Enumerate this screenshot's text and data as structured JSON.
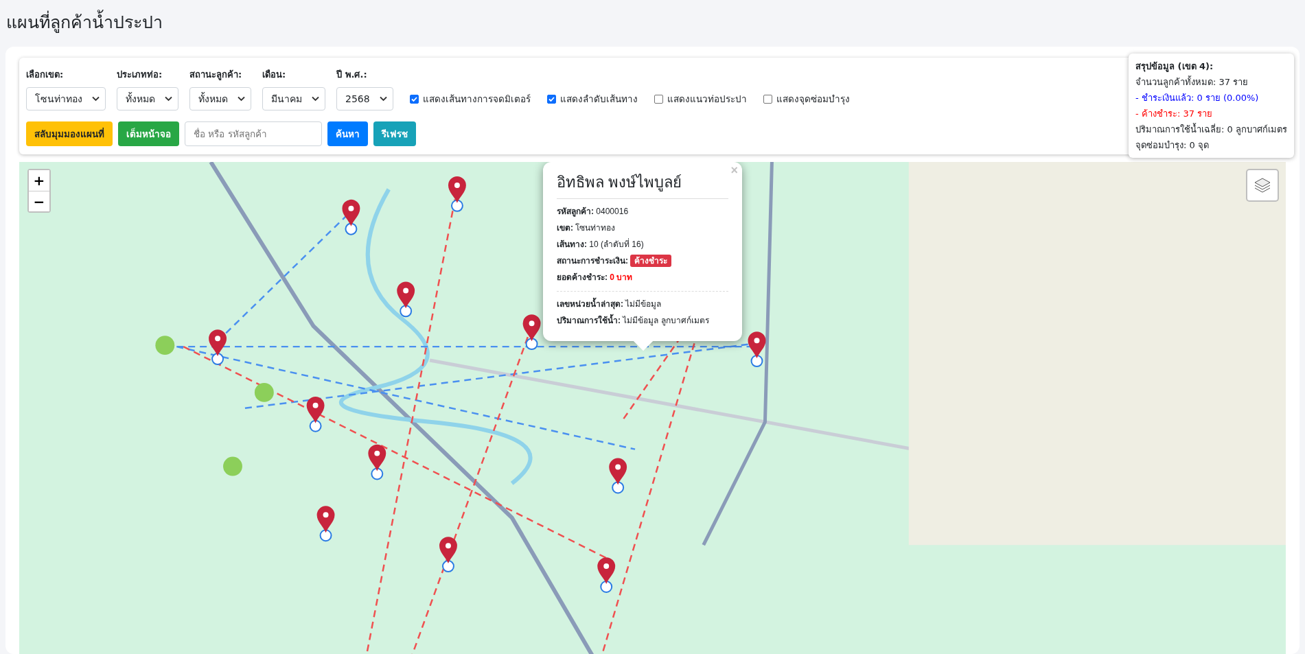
{
  "page": {
    "title": "แผนที่ลูกค้าน้ำประปา"
  },
  "filters": [
    {
      "label": "เลือกเขต:",
      "value": "โซนท่าทอง"
    },
    {
      "label": "ประเภทท่อ:",
      "value": "ทั้งหมด"
    },
    {
      "label": "สถานะลูกค้า:",
      "value": "ทั้งหมด"
    },
    {
      "label": "เดือน:",
      "value": "มีนาคม"
    },
    {
      "label": "ปี พ.ศ.:",
      "value": "2568"
    }
  ],
  "toggles": [
    {
      "label": "แสดงเส้นทางการจดมิเตอร์",
      "checked": true
    },
    {
      "label": "แสดงลำดับเส้นทาง",
      "checked": true
    },
    {
      "label": "แสดงแนวท่อประปา",
      "checked": false
    },
    {
      "label": "แสดงจุดซ่อมบำรุง",
      "checked": false
    }
  ],
  "buttons": [
    {
      "label": "สลับมุมมองแผนที่",
      "kind": "warning"
    },
    {
      "label": "เต็มหน้าจอ",
      "kind": "success"
    }
  ],
  "search": {
    "placeholder": "ชื่อ หรือ รหัสลูกค้า"
  },
  "search_buttons": [
    {
      "label": "ค้นหา",
      "kind": "primary"
    },
    {
      "label": "รีเฟรช",
      "kind": "info"
    }
  ],
  "summary": {
    "title": "สรุปข้อมูล (เขต 4):",
    "lines": [
      {
        "text": "จำนวนลูกค้าทั้งหมด: 37 ราย",
        "kind": "normal"
      },
      {
        "text": "- ชำระเงินแล้ว: 0 ราย (0.00%)",
        "kind": "paid"
      },
      {
        "text": "- ค้างชำระ: 37 ราย",
        "kind": "unpaid"
      },
      {
        "text": "ปริมาณการใช้น้ำเฉลี่ย: 0 ลูกบาศก์เมตร",
        "kind": "normal"
      },
      {
        "text": "จุดซ่อมบำรุง: 0 จุด",
        "kind": "normal"
      }
    ]
  },
  "map": {
    "zoom_in": "+",
    "zoom_out": "−"
  },
  "popup": {
    "close": "×",
    "name": "อิทธิพล พงษ์ไพบูลย์",
    "fields": [
      {
        "label": "รหัสลูกค้า:",
        "value": "0400016",
        "kind": "plain"
      },
      {
        "label": "เขต:",
        "value": "โซนท่าทอง",
        "kind": "plain"
      },
      {
        "label": "เส้นทาง:",
        "value": "10 (ลำดับที่ 16)",
        "kind": "plain"
      },
      {
        "label": "สถานะการชำระเงิน:",
        "value": "ค้างชำระ",
        "kind": "badge"
      },
      {
        "label": "ยอดค้างชำระ:",
        "value": "0 บาท",
        "kind": "alert"
      }
    ],
    "meter_fields": [
      {
        "label": "เลขหน่วยน้ำล่าสุด:",
        "value": "ไม่มีข้อมูล"
      },
      {
        "label": "ปริมาณการใช้น้ำ:",
        "value": "ไม่มีข้อมูล ลูกบาศก์เมตร"
      }
    ]
  }
}
